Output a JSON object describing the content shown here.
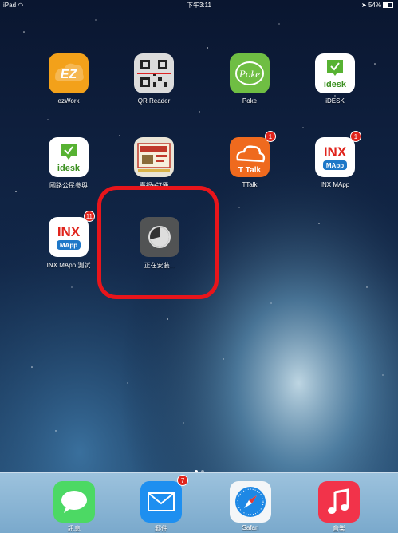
{
  "status_bar": {
    "device": "iPad",
    "time": "下午3:11",
    "battery": "54%"
  },
  "apps": [
    {
      "label": "ezWork",
      "icon": "ezwork-icon",
      "text": "EZ"
    },
    {
      "label": "QR Reader",
      "icon": "qr-reader-icon"
    },
    {
      "label": "Poke",
      "icon": "poke-icon",
      "text": "Poke"
    },
    {
      "label": "iDESK",
      "icon": "idesk-icon",
      "text": "idesk"
    },
    {
      "label": "國路公民參與",
      "icon": "idesk-green-icon",
      "text": "idesk"
    },
    {
      "label": "臺銀e訂通",
      "icon": "bank-ticket-icon"
    },
    {
      "label": "TTalk",
      "icon": "ttalk-icon",
      "text": "T Talk",
      "badge": "1"
    },
    {
      "label": "INX MApp",
      "icon": "inx-mapp-icon",
      "text": "INX",
      "subtext": "MApp",
      "badge": "1"
    },
    {
      "label": "INX MApp 測試",
      "icon": "inx-mapp-test-icon",
      "text": "INX",
      "subtext": "MApp",
      "badge": "11"
    },
    {
      "label": "正在安裝...",
      "icon": "installing-progress-icon"
    }
  ],
  "dock": [
    {
      "label": "訊息",
      "icon": "messages-icon"
    },
    {
      "label": "郵件",
      "icon": "mail-icon",
      "badge": "7"
    },
    {
      "label": "Safari",
      "icon": "safari-icon"
    },
    {
      "label": "音樂",
      "icon": "music-icon"
    }
  ],
  "colors": {
    "highlight": "#e8151b",
    "badge": "#e0231b"
  }
}
